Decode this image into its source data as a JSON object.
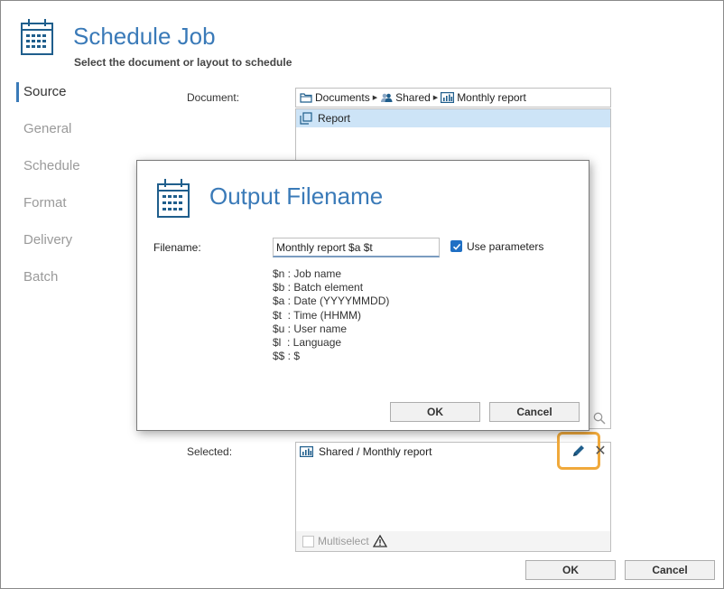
{
  "header": {
    "title": "Schedule Job",
    "subtitle": "Select the document or layout to schedule"
  },
  "nav": {
    "items": [
      {
        "label": "Source",
        "active": true
      },
      {
        "label": "General",
        "active": false
      },
      {
        "label": "Schedule",
        "active": false
      },
      {
        "label": "Format",
        "active": false
      },
      {
        "label": "Delivery",
        "active": false
      },
      {
        "label": "Batch",
        "active": false
      }
    ]
  },
  "source": {
    "document_label": "Document:",
    "path": [
      "Documents",
      "Shared",
      "Monthly report"
    ],
    "list_items": [
      "Report"
    ],
    "selected_label": "Selected:",
    "selected_items": [
      "Shared / Monthly report"
    ],
    "multiselect_label": "Multiselect"
  },
  "footer": {
    "ok_label": "OK",
    "cancel_label": "Cancel"
  },
  "dialog": {
    "title": "Output Filename",
    "filename_label": "Filename:",
    "filename_value": "Monthly report $a $t",
    "use_parameters_label": "Use parameters",
    "use_parameters_checked": true,
    "parameters": [
      "$n : Job name",
      "$b : Batch element",
      "$a : Date (YYYYMMDD)",
      "$t  : Time (HHMM)",
      "$u : User name",
      "$l  : Language",
      "$$ : $"
    ],
    "ok_label": "OK",
    "cancel_label": "Cancel"
  },
  "colors": {
    "accent": "#3a7ab8",
    "highlight": "#f0a93b",
    "selection": "#cde4f7"
  }
}
